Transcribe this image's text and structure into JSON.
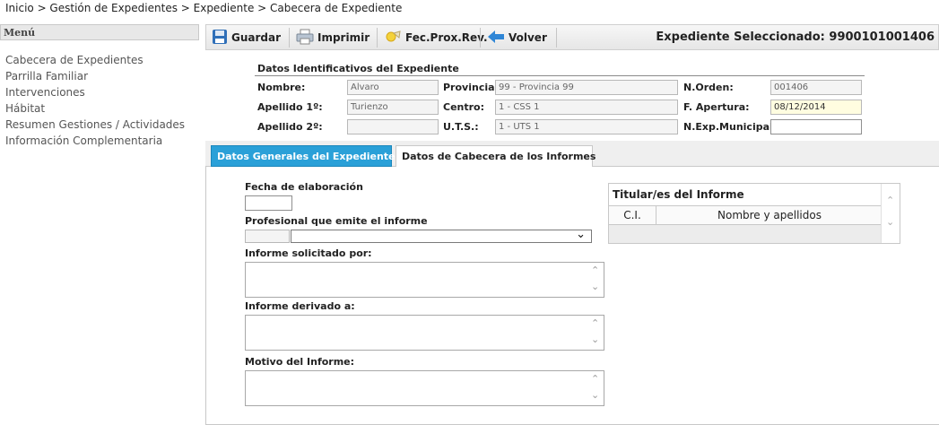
{
  "breadcrumb": "Inicio > Gestión de Expedientes > Expediente > Cabecera de Expediente",
  "menu": {
    "title": "Menú",
    "items": [
      "Cabecera de Expedientes",
      "Parrilla Familiar",
      "Intervenciones",
      "Hábitat",
      "Resumen Gestiones / Actividades",
      "Información Complementaria"
    ]
  },
  "toolbar": {
    "save": "Guardar",
    "print": "Imprimir",
    "next_review": "Fec.Prox.Rev.",
    "back": "Volver",
    "selected": "Expediente Seleccionado: 9900101001406"
  },
  "header": {
    "title": "Datos Identificativos del Expediente",
    "nombre_label": "Nombre:",
    "nombre_value": "Alvaro",
    "apellido1_label": "Apellido 1º:",
    "apellido1_value": "Turienzo",
    "apellido2_label": "Apellido 2º:",
    "apellido2_value": "",
    "provincia_label": "Provincia:",
    "provincia_value": "99 - Provincia 99",
    "centro_label": "Centro:",
    "centro_value": "1 - CSS 1",
    "uts_label": "U.T.S.:",
    "uts_value": "1 - UTS 1",
    "norden_label": "N.Orden:",
    "norden_value": "001406",
    "fapertura_label": "F. Apertura:",
    "fapertura_value": "08/12/2014",
    "nexp_label": "N.Exp.Municipal:",
    "nexp_value": ""
  },
  "tabs": {
    "active": "Datos Generales del Expediente",
    "inactive": "Datos de Cabecera de los Informes"
  },
  "form": {
    "fecha_label": "Fecha de elaboración",
    "profesional_label": "Profesional que emite el informe",
    "solicitado_label": "Informe solicitado por:",
    "derivado_label": "Informe derivado a:",
    "motivo_label": "Motivo del Informe:"
  },
  "titulares": {
    "title": "Titular/es del Informe",
    "col_ci": "C.I.",
    "col_nombre": "Nombre y apellidos"
  },
  "colors": {
    "tab_active": "#2aa0d8",
    "date_highlight": "#fffde0"
  }
}
